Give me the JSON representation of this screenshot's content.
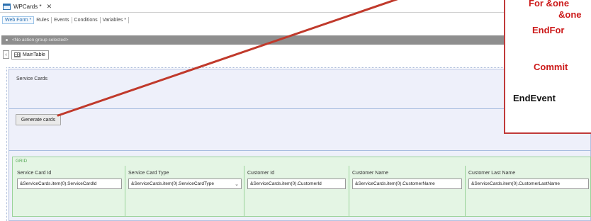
{
  "document_tab": {
    "label": "WPCards *",
    "close_label": "✕"
  },
  "part_tabs": [
    {
      "label": "Web Form *",
      "active": true
    },
    {
      "label": "Rules",
      "active": false
    },
    {
      "label": "Events",
      "active": false
    },
    {
      "label": "Conditions",
      "active": false
    },
    {
      "label": "Variables *",
      "active": false
    }
  ],
  "action_bar": {
    "text": "<No action group selected>"
  },
  "breadcrumb": {
    "back_label": "‹",
    "table_label": "MainTable"
  },
  "form": {
    "service_cards_title": "Service Cards",
    "generate_button_label": "Generate cards",
    "grid_label": "GRID",
    "columns": [
      {
        "header": "Service Card Id",
        "value": "&ServiceCards.item(0).ServiceCardId",
        "dropdown": false
      },
      {
        "header": "Service Card Type",
        "value": "&ServiceCards.item(0).ServiceCardType",
        "dropdown": true
      },
      {
        "header": "Customer Id",
        "value": "&ServiceCards.item(0).CustomerId",
        "dropdown": false
      },
      {
        "header": "Customer Name",
        "value": "&ServiceCards.item(0).CustomerName",
        "dropdown": false
      },
      {
        "header": "Customer Last Name",
        "value": "&ServiceCards.item(0).CustomerLastName",
        "dropdown": false
      }
    ]
  },
  "code_overlay": {
    "lines": [
      "For &one",
      "&one",
      "EndFor",
      "Commit",
      "EndEvent"
    ]
  },
  "colors": {
    "annotation_red": "#c0392b",
    "grid_green": "#e4f5e4",
    "table_blue": "#eef0fa"
  }
}
